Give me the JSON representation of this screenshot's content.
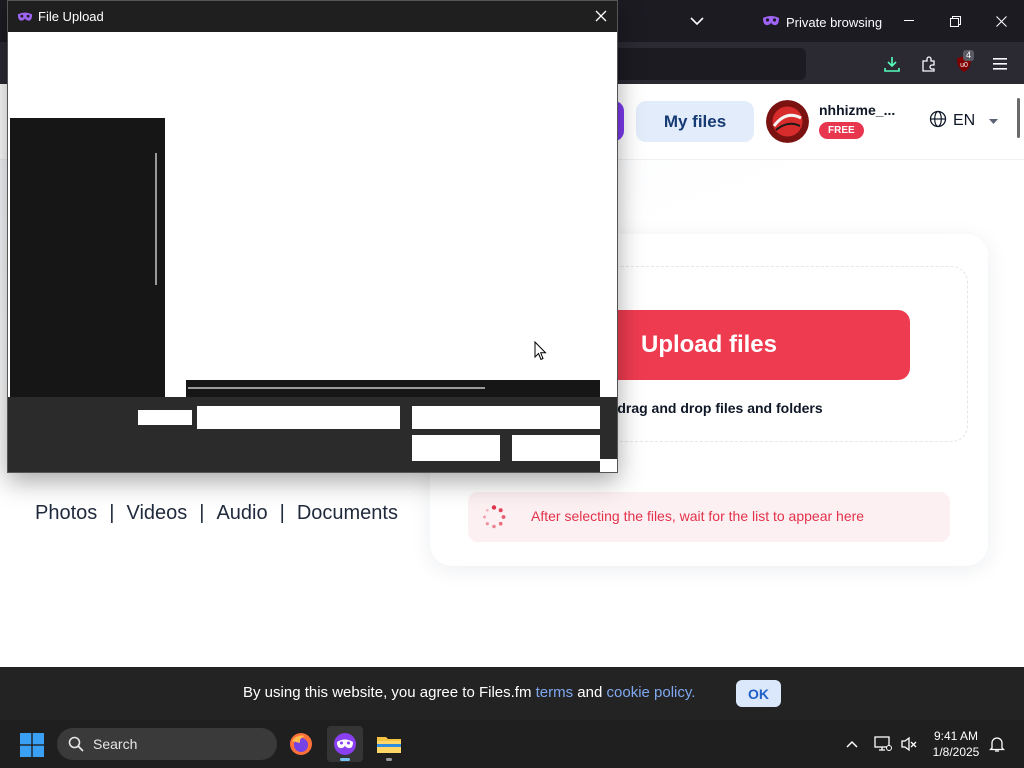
{
  "browser": {
    "private_label": "Private browsing",
    "extension_badge": "4"
  },
  "site": {
    "my_files_label": "My files",
    "username": "nhhizme_...",
    "plan_badge": "FREE",
    "language": "EN"
  },
  "upload": {
    "button_label": "Upload files",
    "drag_hint": "drag and drop files and folders",
    "wait_notice": "After selecting the files, wait for the list to appear here"
  },
  "categories": [
    "Photos",
    "Videos",
    "Audio",
    "Documents"
  ],
  "cookie": {
    "text_before": "By using this website, you agree to Files.fm ",
    "terms_link": "terms",
    "text_middle": " and ",
    "policy_link": "cookie policy.",
    "ok_label": "OK"
  },
  "dialog": {
    "title": "File Upload"
  },
  "taskbar": {
    "search_label": "Search",
    "time": "9:41 AM",
    "date": "1/8/2025"
  },
  "colors": {
    "accent_red": "#ef3b50",
    "my_files_bg": "#e3ecfb",
    "link_blue": "#7fa8f0"
  }
}
